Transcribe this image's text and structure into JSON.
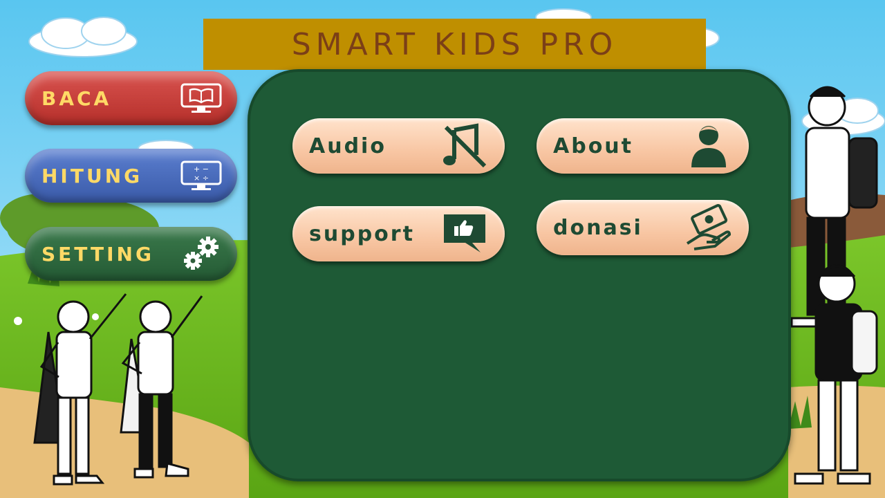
{
  "app": {
    "title": "SMART KIDS PRO"
  },
  "sidebar": {
    "items": [
      {
        "label": "BACA",
        "icon": "book-monitor-icon",
        "color": "#c0392b"
      },
      {
        "label": "HITUNG",
        "icon": "calculator-monitor-icon",
        "color": "#3f63b5"
      },
      {
        "label": "SETTING",
        "icon": "gears-icon",
        "color": "#2e5e3b"
      }
    ]
  },
  "settings_menu": {
    "buttons": [
      {
        "label": "Audio",
        "icon": "music-off-icon"
      },
      {
        "label": "About",
        "icon": "person-icon"
      },
      {
        "label": "support",
        "icon": "thumbs-up-chat-icon"
      },
      {
        "label": "donasi",
        "icon": "money-hand-icon"
      }
    ]
  },
  "colors": {
    "title_bar": "#bf8f00",
    "title_text": "#7b3f17",
    "board": "#1e5a36",
    "button_peach": "#f8c6a3",
    "button_text": "#1e4a33",
    "nav_text": "#ffd966"
  }
}
